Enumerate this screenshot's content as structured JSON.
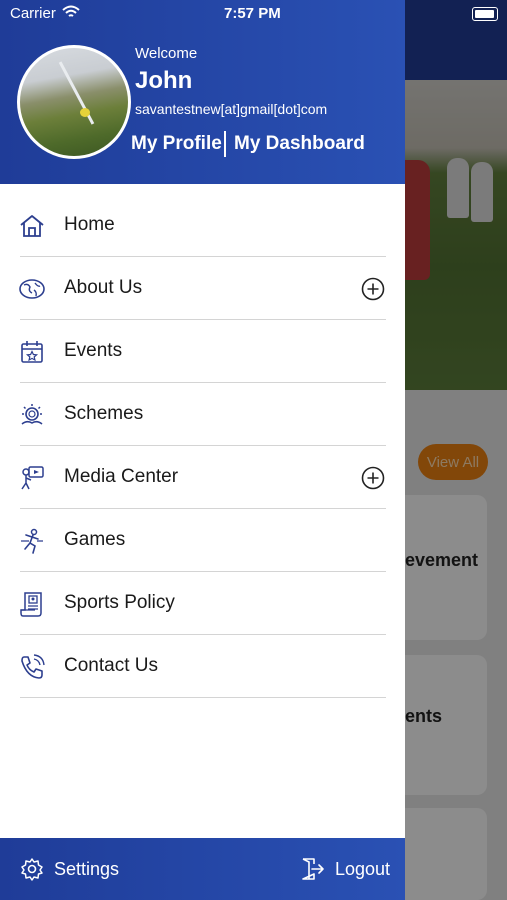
{
  "status_bar": {
    "carrier": "Carrier",
    "time": "7:57 PM"
  },
  "drawer": {
    "header": {
      "welcome": "Welcome",
      "username": "John",
      "email": "savantestnew[at]gmail[dot]com",
      "my_profile": "My Profile",
      "my_dashboard": "My Dashboard"
    },
    "menu": [
      {
        "label": "Home",
        "icon": "home-icon",
        "expandable": false
      },
      {
        "label": "About Us",
        "icon": "globe-icon",
        "expandable": true
      },
      {
        "label": "Events",
        "icon": "calendar-star-icon",
        "expandable": false
      },
      {
        "label": "Schemes",
        "icon": "award-icon",
        "expandable": false
      },
      {
        "label": "Media Center",
        "icon": "media-icon",
        "expandable": true
      },
      {
        "label": "Games",
        "icon": "athlete-icon",
        "expandable": false
      },
      {
        "label": "Sports Policy",
        "icon": "policy-document-icon",
        "expandable": false
      },
      {
        "label": "Contact Us",
        "icon": "phone-icon",
        "expandable": false
      }
    ],
    "footer": {
      "settings": "Settings",
      "logout": "Logout"
    }
  },
  "background": {
    "view_all": "View All",
    "card1_partial_title": "evement",
    "card2_partial_title": "ents"
  },
  "colors": {
    "brand_blue": "#2447a8",
    "accent_orange": "#e07a10",
    "icon_blue": "#2d3f8f"
  }
}
